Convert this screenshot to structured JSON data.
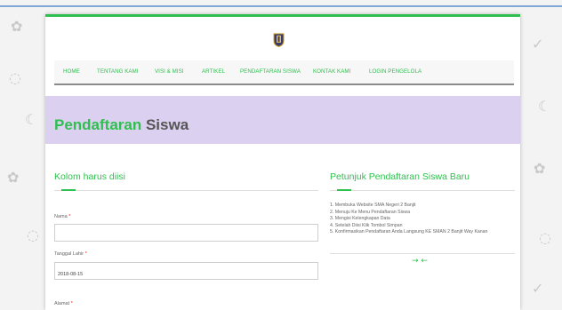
{
  "nav": {
    "items": [
      "HOME",
      "TENTANG KAMI",
      "VISI & MISI",
      "ARTIKEL",
      "PENDAFTARAN SISWA",
      "KONTAK KAMI",
      "LOGIN PENGELOLA"
    ]
  },
  "hero": {
    "title_accent": "Pendaftaran",
    "title_rest": " Siswa"
  },
  "form": {
    "section_title": "Kolom harus diisi",
    "name_label": "Nama",
    "name_value": "",
    "dob_label": "Tanggal Lahir",
    "dob_value": "2018-08-15",
    "address_label": "Alamat",
    "required_mark": "*"
  },
  "guide": {
    "title": "Petunjuk Pendaftaran Siswa Baru",
    "steps": [
      "1. Membuka Website SMA Negeri 2 Banjit",
      "2. Menuju Ke Menu Pendaftaran Siswa",
      "3. Mengisi Kelengkapan Data",
      "4. Setelah Diisi Klik Tombol Simpan",
      "5. Konfirmasikan Pendaftaran Anda Langsung KE SMAN 2 Banjit Way Kanan"
    ],
    "arrows": "→ ←"
  },
  "colors": {
    "accent": "#2fbf4f",
    "hero_bg": "#dcd0f0",
    "title_gray": "#555555"
  },
  "icons": {
    "logo": "school-crest-icon"
  }
}
